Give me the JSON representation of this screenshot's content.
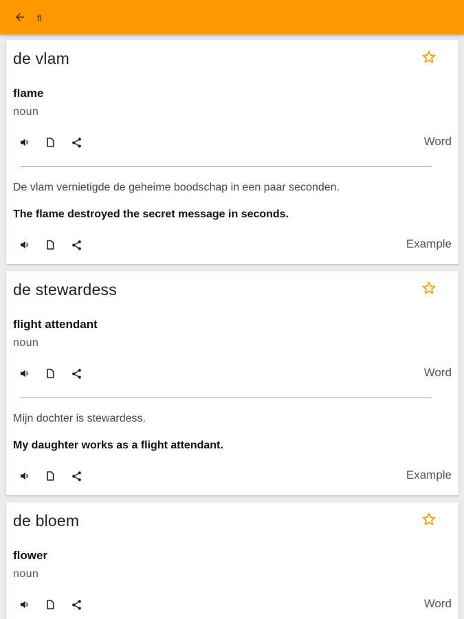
{
  "appbar": {
    "query": "fl",
    "accent_color": "#ff9800"
  },
  "icons": {
    "back": "arrow-left-icon",
    "favorite": "star-outline-icon",
    "audio": "speaker-icon",
    "copy": "copy-icon",
    "share": "share-icon"
  },
  "cards": [
    {
      "term": "de vlam",
      "translation": "flame",
      "part_of_speech": "noun",
      "word_label": "Word",
      "example_source": "De vlam vernietigde de geheime boodschap in een paar seconden.",
      "example_target": "The flame destroyed the secret message in seconds.",
      "example_label": "Example"
    },
    {
      "term": "de stewardess",
      "translation": "flight attendant",
      "part_of_speech": "noun",
      "word_label": "Word",
      "example_source": "Mijn dochter is stewardess.",
      "example_target": "My daughter works as a flight attendant.",
      "example_label": "Example"
    },
    {
      "term": "de bloem",
      "translation": "flower",
      "part_of_speech": "noun",
      "word_label": "Word"
    }
  ]
}
